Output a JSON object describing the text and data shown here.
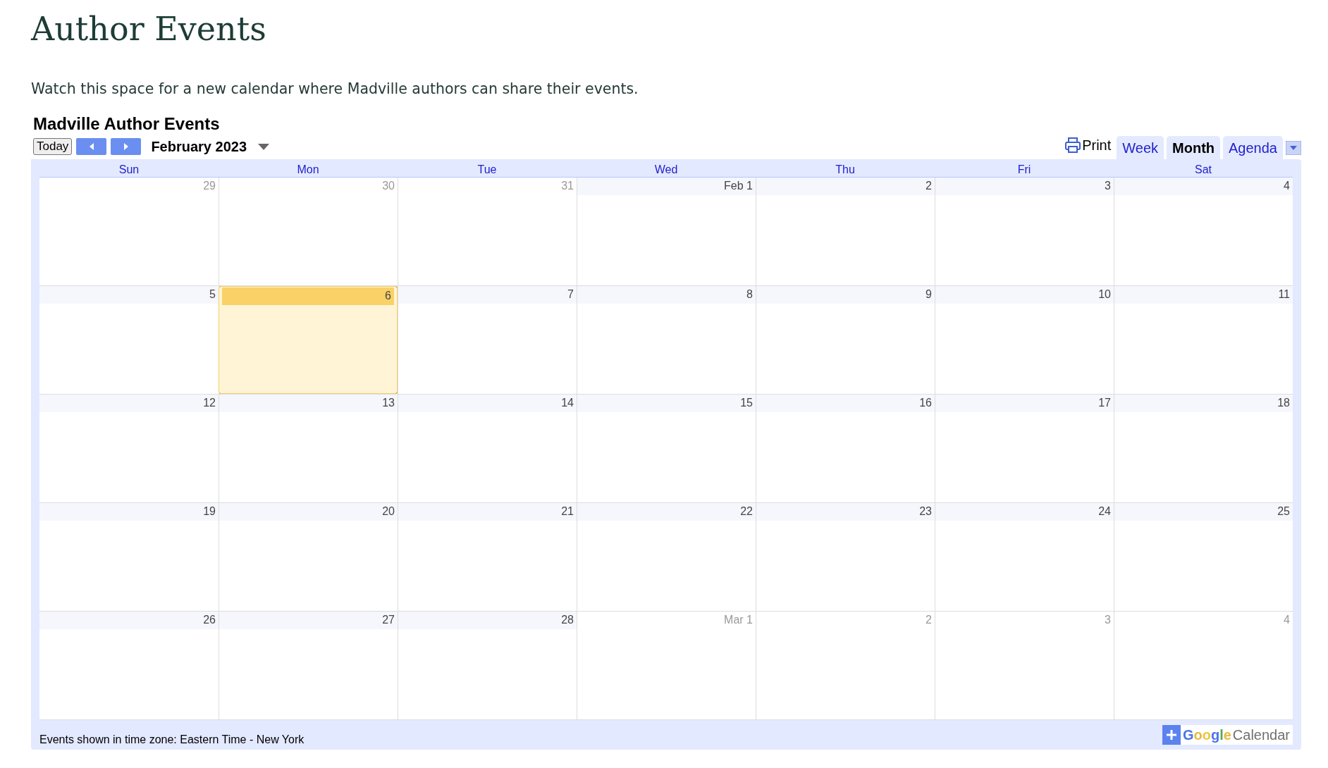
{
  "page_title": "Author Events",
  "intro": "Watch this space for a new calendar where Madville authors can share their events.",
  "calendar": {
    "title": "Madville Author Events",
    "toolbar": {
      "today": "Today",
      "period": "February 2023",
      "print": "Print",
      "views": [
        {
          "label": "Week",
          "selected": false
        },
        {
          "label": "Month",
          "selected": true
        },
        {
          "label": "Agenda",
          "selected": false
        }
      ]
    },
    "weekdays": [
      "Sun",
      "Mon",
      "Tue",
      "Wed",
      "Thu",
      "Fri",
      "Sat"
    ],
    "weeks": [
      {
        "days": [
          {
            "label": "29",
            "other_month": true,
            "today": false
          },
          {
            "label": "30",
            "other_month": true,
            "today": false
          },
          {
            "label": "31",
            "other_month": true,
            "today": false
          },
          {
            "label": "Feb 1",
            "other_month": false,
            "today": false
          },
          {
            "label": "2",
            "other_month": false,
            "today": false
          },
          {
            "label": "3",
            "other_month": false,
            "today": false
          },
          {
            "label": "4",
            "other_month": false,
            "today": false
          }
        ]
      },
      {
        "days": [
          {
            "label": "5",
            "other_month": false,
            "today": false
          },
          {
            "label": "6",
            "other_month": false,
            "today": true
          },
          {
            "label": "7",
            "other_month": false,
            "today": false
          },
          {
            "label": "8",
            "other_month": false,
            "today": false
          },
          {
            "label": "9",
            "other_month": false,
            "today": false
          },
          {
            "label": "10",
            "other_month": false,
            "today": false
          },
          {
            "label": "11",
            "other_month": false,
            "today": false
          }
        ]
      },
      {
        "days": [
          {
            "label": "12",
            "other_month": false,
            "today": false
          },
          {
            "label": "13",
            "other_month": false,
            "today": false
          },
          {
            "label": "14",
            "other_month": false,
            "today": false
          },
          {
            "label": "15",
            "other_month": false,
            "today": false
          },
          {
            "label": "16",
            "other_month": false,
            "today": false
          },
          {
            "label": "17",
            "other_month": false,
            "today": false
          },
          {
            "label": "18",
            "other_month": false,
            "today": false
          }
        ]
      },
      {
        "days": [
          {
            "label": "19",
            "other_month": false,
            "today": false
          },
          {
            "label": "20",
            "other_month": false,
            "today": false
          },
          {
            "label": "21",
            "other_month": false,
            "today": false
          },
          {
            "label": "22",
            "other_month": false,
            "today": false
          },
          {
            "label": "23",
            "other_month": false,
            "today": false
          },
          {
            "label": "24",
            "other_month": false,
            "today": false
          },
          {
            "label": "25",
            "other_month": false,
            "today": false
          }
        ]
      },
      {
        "days": [
          {
            "label": "26",
            "other_month": false,
            "today": false
          },
          {
            "label": "27",
            "other_month": false,
            "today": false
          },
          {
            "label": "28",
            "other_month": false,
            "today": false
          },
          {
            "label": "Mar 1",
            "other_month": true,
            "today": false
          },
          {
            "label": "2",
            "other_month": true,
            "today": false
          },
          {
            "label": "3",
            "other_month": true,
            "today": false
          },
          {
            "label": "4",
            "other_month": true,
            "today": false
          }
        ]
      }
    ],
    "footer": {
      "timezone": "Events shown in time zone: Eastern Time - New York",
      "logo_brand": "Google",
      "logo_product": "Calendar"
    }
  }
}
